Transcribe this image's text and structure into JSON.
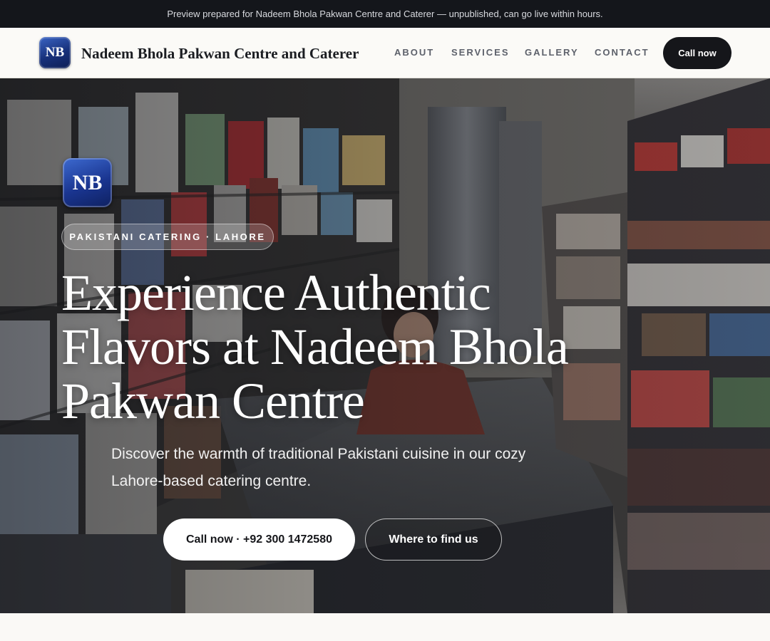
{
  "preview_bar": {
    "text": "Preview prepared for Nadeem Bhola Pakwan Centre and Caterer — unpublished, can go live within hours."
  },
  "nav": {
    "logo_initials": "NB",
    "brand": "Nadeem Bhola Pakwan Centre and Caterer",
    "links": [
      "ABOUT",
      "SERVICES",
      "GALLERY",
      "CONTACT"
    ],
    "cta": "Call now"
  },
  "hero": {
    "logo_initials": "NB",
    "badge": "PAKISTANI CATERING · LAHORE",
    "title": "Experience Authentic Flavors at Nadeem Bhola Pakwan Centre",
    "subtitle": "Discover the warmth of traditional Pakistani cuisine in our cozy Lahore-based catering centre.",
    "primary_button": "Call now · +92 300 1472580",
    "secondary_button": "Where to find us",
    "background_image": "shop-interior-photo"
  },
  "colors": {
    "preview_bar": "#14161b",
    "nav_background": "#fbfaf7",
    "cta_dark": "#15161a",
    "logo_blue": "#1a3590"
  }
}
